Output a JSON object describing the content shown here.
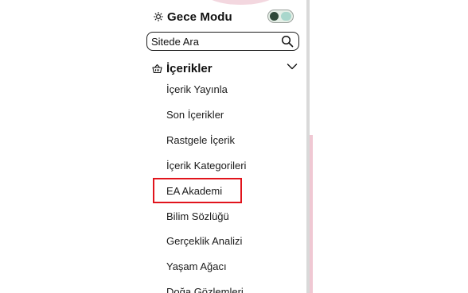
{
  "night_mode": {
    "label": "Gece Modu",
    "icon": "sun-icon",
    "toggle_on": false
  },
  "search": {
    "placeholder": "Sitede Ara",
    "icon": "search-icon"
  },
  "section": {
    "title": "İçerikler",
    "icon": "basket-icon",
    "expanded": true,
    "chevron_icon": "chevron-down-icon"
  },
  "menu": {
    "items": [
      {
        "label": "İçerik Yayınla"
      },
      {
        "label": "Son İçerikler"
      },
      {
        "label": "Rastgele İçerik"
      },
      {
        "label": "İçerik Kategorileri"
      },
      {
        "label": "EA Akademi",
        "highlighted": true
      },
      {
        "label": "Bilim Sözlüğü"
      },
      {
        "label": "Gerçeklik Analizi"
      },
      {
        "label": "Yaşam Ağacı"
      },
      {
        "label": "Doğa Gözlemleri"
      }
    ]
  },
  "colors": {
    "highlight_border": "#e1141c",
    "accent_pink": "#f3d7df",
    "toggle_track": "#e5efe7"
  }
}
